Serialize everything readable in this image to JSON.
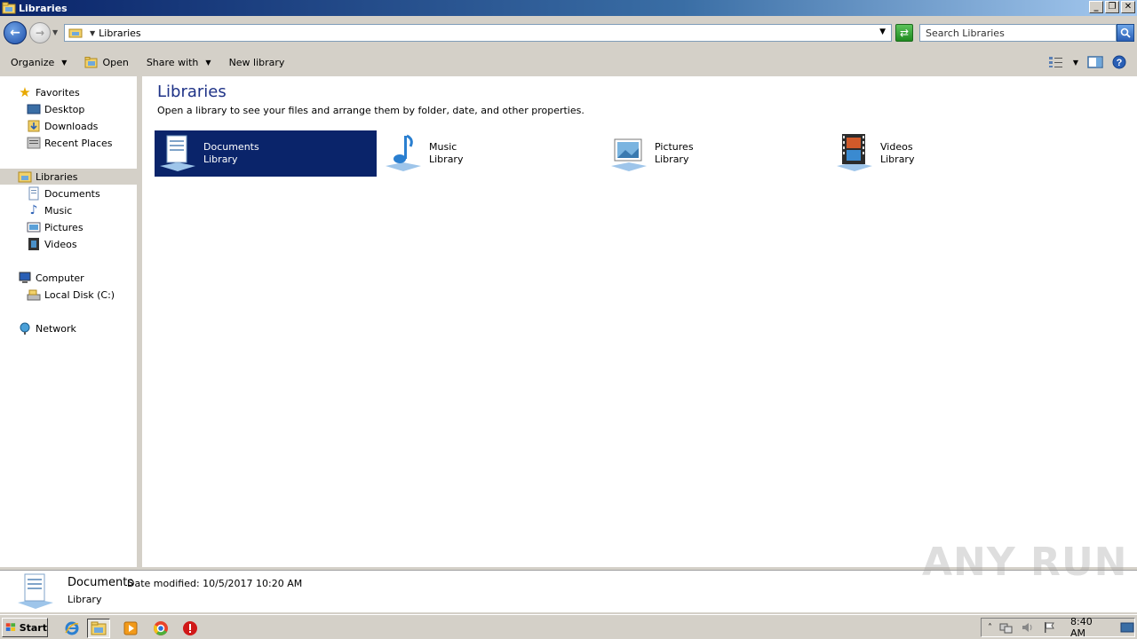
{
  "window": {
    "title": "Libraries",
    "controls": {
      "minimize": "_",
      "maximize": "❐",
      "close": "✕"
    }
  },
  "address": {
    "path": "Libraries",
    "search_placeholder": "Search Libraries"
  },
  "toolbar": {
    "organize": "Organize",
    "open": "Open",
    "share_with": "Share with",
    "new_library": "New library"
  },
  "nav": {
    "favorites": "Favorites",
    "desktop": "Desktop",
    "downloads": "Downloads",
    "recent_places": "Recent Places",
    "libraries": "Libraries",
    "documents": "Documents",
    "music": "Music",
    "pictures": "Pictures",
    "videos": "Videos",
    "computer": "Computer",
    "local_disk": "Local Disk (C:)",
    "network": "Network"
  },
  "content": {
    "title": "Libraries",
    "subtitle": "Open a library to see your files and arrange them by folder, date, and other properties.",
    "libraries": [
      {
        "name": "Documents",
        "type": "Library",
        "icon": "documents-library-icon",
        "selected": true
      },
      {
        "name": "Music",
        "type": "Library",
        "icon": "music-library-icon",
        "selected": false
      },
      {
        "name": "Pictures",
        "type": "Library",
        "icon": "pictures-library-icon",
        "selected": false
      },
      {
        "name": "Videos",
        "type": "Library",
        "icon": "videos-library-icon",
        "selected": false
      }
    ]
  },
  "details": {
    "name": "Documents",
    "modified": "Date modified: 10/5/2017 10:20 AM",
    "type": "Library"
  },
  "watermark": "ANY RUN",
  "taskbar": {
    "start": "Start",
    "clock": "8:40 AM"
  },
  "colors": {
    "selection": "#0a246a",
    "title_text": "#1e3287"
  }
}
